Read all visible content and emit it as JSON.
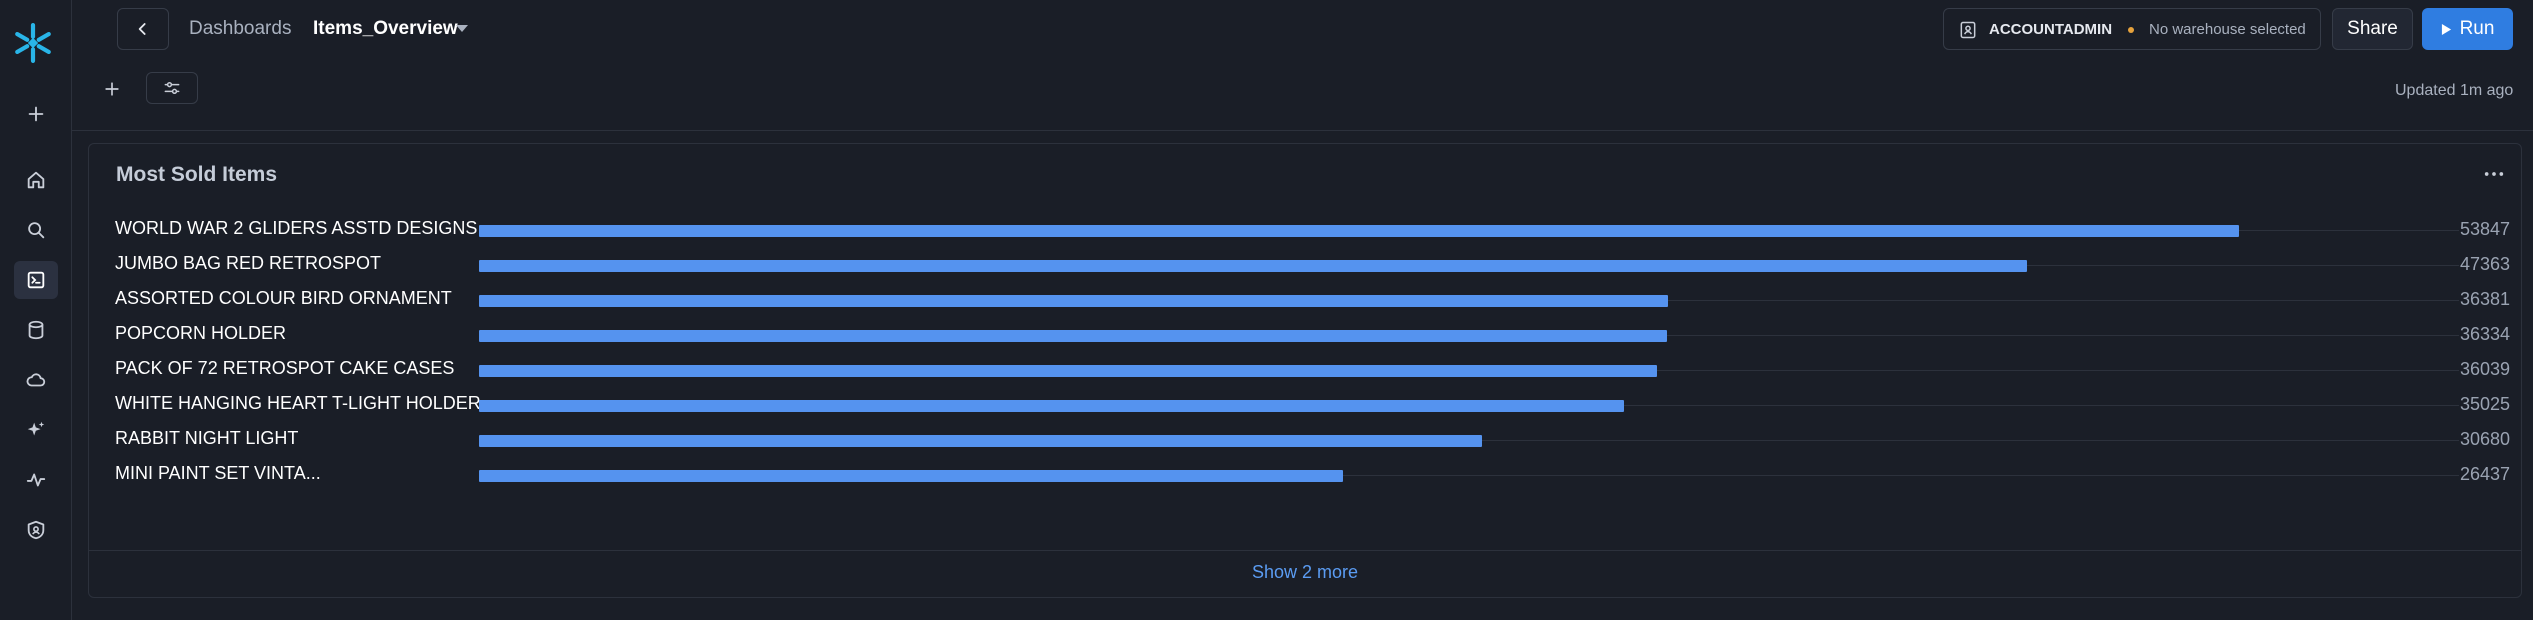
{
  "breadcrumb": {
    "parent": "Dashboards",
    "title": "Items_Overview"
  },
  "context": {
    "role": "ACCOUNTADMIN",
    "warehouse": "No warehouse selected"
  },
  "actions": {
    "share": "Share",
    "run": "Run"
  },
  "status": {
    "updated": "Updated 1m ago"
  },
  "colors": {
    "accent": "#2f7de1",
    "bar": "#5593ef",
    "background": "#1a1e27",
    "warehouse_dot": "#e6a23c"
  },
  "sidebar_icons": [
    "add-icon",
    "home-icon",
    "search-icon",
    "worksheet-icon",
    "database-icon",
    "cloud-icon",
    "ai-sparkle-icon",
    "activity-icon",
    "admin-shield-icon"
  ],
  "card": {
    "title": "Most Sold Items",
    "show_more": "Show 2 more"
  },
  "chart_data": {
    "type": "bar",
    "orientation": "horizontal",
    "categories": [
      "WORLD WAR 2 GLIDERS ASSTD DESIGNS",
      "JUMBO BAG RED RETROSPOT",
      "ASSORTED COLOUR BIRD ORNAMENT",
      "POPCORN HOLDER",
      "PACK OF 72 RETROSPOT CAKE CASES",
      "WHITE HANGING HEART T-LIGHT HOLDER",
      "RABBIT NIGHT LIGHT",
      "MINI PAINT SET VINTA..."
    ],
    "values": [
      53847,
      47363,
      36381,
      36334,
      36039,
      35025,
      30680,
      26437
    ],
    "value_labels": [
      "53847",
      "47363",
      "36381",
      "36334",
      "36039",
      "35025",
      "30680",
      "26437"
    ],
    "xlim": [
      0,
      54000
    ],
    "grid": true,
    "legend": "none"
  }
}
